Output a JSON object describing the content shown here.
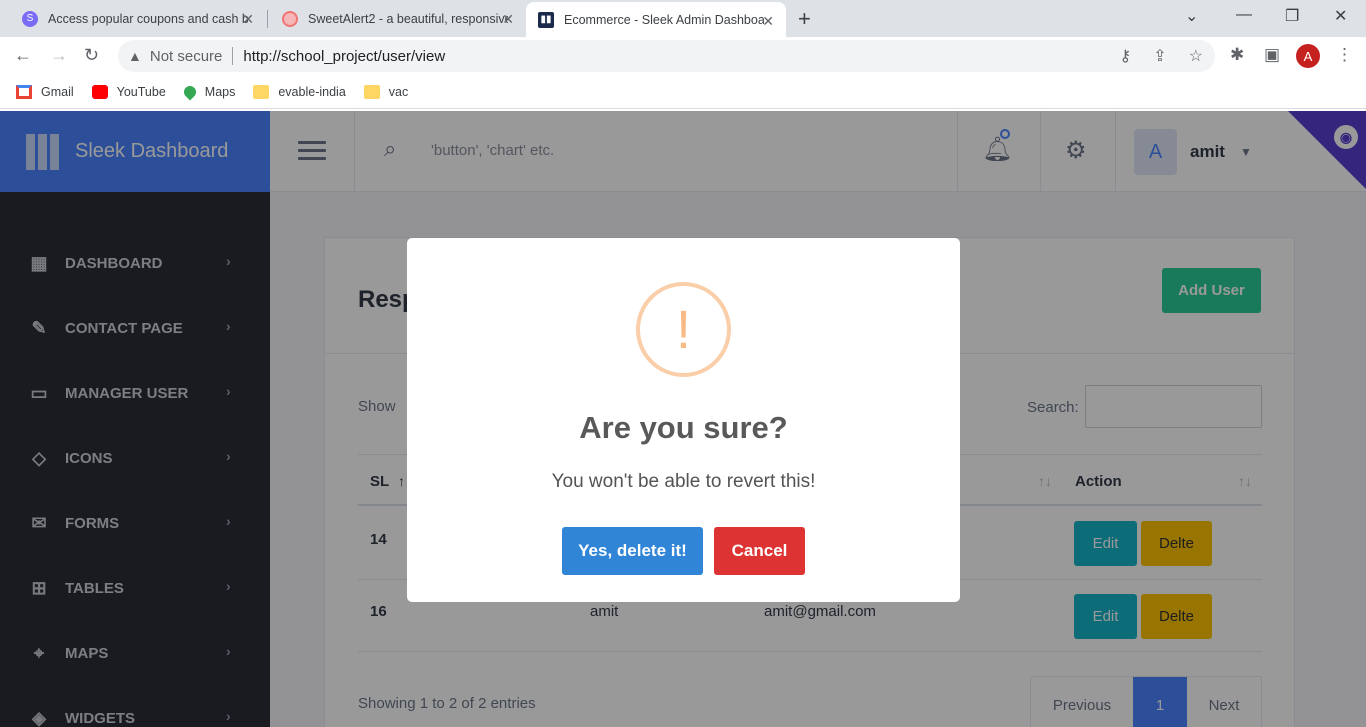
{
  "browser": {
    "tabs": [
      {
        "title": "Access popular coupons and cash b",
        "favicon": "s-circle-icon",
        "color": "#7b6cf6"
      },
      {
        "title": "SweetAlert2 - a beautiful, responsive",
        "favicon": "swirl-icon",
        "color": "#f27474"
      },
      {
        "title": "Ecommerce - Sleek Admin Dashboa",
        "favicon": "sleek-logo-icon",
        "color": "#1b2a4a"
      }
    ],
    "security_label": "Not secure",
    "url": "http://school_project/user/view",
    "profile_initial": "A",
    "bookmarks": [
      {
        "label": "Gmail",
        "icon": "gmail-icon"
      },
      {
        "label": "YouTube",
        "icon": "youtube-icon"
      },
      {
        "label": "Maps",
        "icon": "maps-icon"
      },
      {
        "label": "evable-india",
        "icon": "folder-icon"
      },
      {
        "label": "vac",
        "icon": "folder-icon"
      }
    ]
  },
  "app": {
    "brand": "Sleek Dashboard",
    "search_placeholder": "'button', 'chart' etc.",
    "user_initial": "A",
    "user_name": "amit",
    "colors": {
      "primary": "#4c84ff",
      "sidebar": "#2a2d36",
      "success": "#29cc97",
      "info": "#15b5c8",
      "warning": "#fec400"
    },
    "menu": [
      {
        "label": "DASHBOARD",
        "icon": "dashboard-icon"
      },
      {
        "label": "CONTACT PAGE",
        "icon": "edit-icon"
      },
      {
        "label": "MANAGER USER",
        "icon": "folders-icon"
      },
      {
        "label": "ICONS",
        "icon": "diamond-icon"
      },
      {
        "label": "FORMS",
        "icon": "email-open-icon"
      },
      {
        "label": "TABLES",
        "icon": "table-icon"
      },
      {
        "label": "MAPS",
        "icon": "map-icon"
      },
      {
        "label": "WIDGETS",
        "icon": "widgets-icon"
      }
    ]
  },
  "content": {
    "title": "Resp",
    "add_user": "Add User",
    "show_label": "Show",
    "search_label": "Search:",
    "columns": {
      "sl": "SL",
      "action": "Action"
    },
    "rows": [
      {
        "sl": "14",
        "name": "",
        "email": "",
        "edit": "Edit",
        "delete": "Delte"
      },
      {
        "sl": "16",
        "name": "amit",
        "email": "amit@gmail.com",
        "edit": "Edit",
        "delete": "Delte"
      }
    ],
    "info": "Showing 1 to 2 of 2 entries",
    "pagination": {
      "previous": "Previous",
      "current": "1",
      "next": "Next"
    }
  },
  "modal": {
    "icon": "warning-icon",
    "icon_glyph": "!",
    "title": "Are you sure?",
    "text": "You won't be able to revert this!",
    "confirm": "Yes, delete it!",
    "cancel": "Cancel"
  }
}
